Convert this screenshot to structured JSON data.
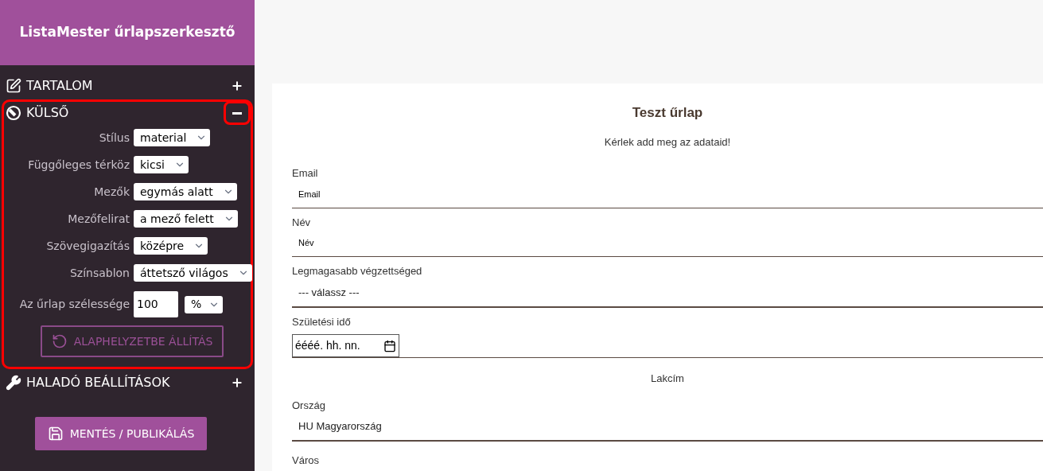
{
  "app_title": "ListaMester űrlapszerkesztő",
  "sections": [
    {
      "kind": "content",
      "title": "TARTALOM",
      "expanded": false,
      "highlighted": false,
      "toggle_highlighted": false
    },
    {
      "kind": "appearance",
      "title": "KÜLSŐ",
      "expanded": true,
      "highlighted": true,
      "toggle_highlighted": true,
      "settings": [
        {
          "kind": "select",
          "label": "Stílus",
          "value": "material"
        },
        {
          "kind": "select",
          "label": "Függőleges térköz",
          "value": "kicsi"
        },
        {
          "kind": "select",
          "label": "Mezők",
          "value": "egymás alatt"
        },
        {
          "kind": "select",
          "label": "Mezőfelirat",
          "value": "a mező felett"
        },
        {
          "kind": "select",
          "label": "Szövegigazítás",
          "value": "középre"
        },
        {
          "kind": "select",
          "label": "Színsablon",
          "value": "áttetsző világos"
        },
        {
          "kind": "number_unit",
          "label": "Az űrlap szélessége",
          "value": "100",
          "unit": "%"
        }
      ],
      "reset_button": "ALAPHELYZETBE ÁLLÍTÁS"
    },
    {
      "kind": "advanced",
      "title": "HALADÓ BEÁLLÍTÁSOK",
      "expanded": false,
      "highlighted": false,
      "toggle_highlighted": false
    }
  ],
  "save_button": "MENTÉS / PUBLIKÁLÁS",
  "form": {
    "title": "Teszt űrlap",
    "subtitle": "Kérlek add meg az adataid!",
    "fields": [
      {
        "kind": "text",
        "label": "Email",
        "placeholder": "Email"
      },
      {
        "kind": "text",
        "label": "Név",
        "placeholder": "Név"
      },
      {
        "kind": "select",
        "label": "Legmagasabb végzettséged",
        "value": "--- válassz ---"
      },
      {
        "kind": "date",
        "label": "Születési idő",
        "placeholder": "éééé. hh. nn."
      },
      {
        "kind": "heading",
        "label": "Lakcím"
      },
      {
        "kind": "select",
        "label": "Ország",
        "value": "HU Magyarország"
      },
      {
        "kind": "label_only",
        "label": "Város"
      }
    ]
  }
}
